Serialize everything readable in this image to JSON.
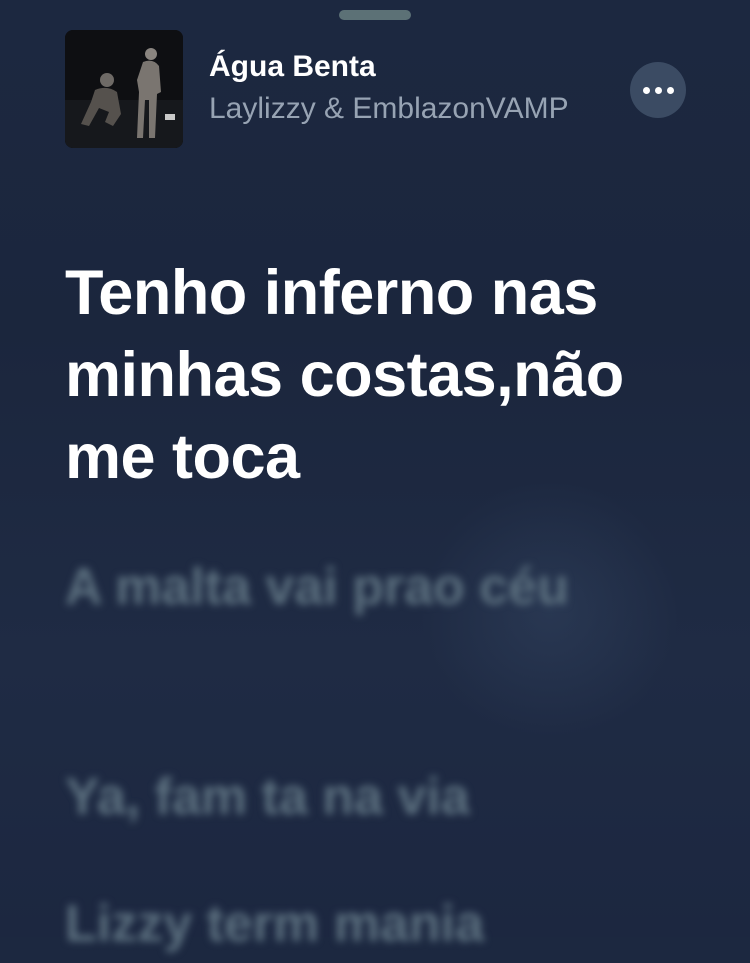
{
  "now_playing": {
    "title": "Água Benta",
    "artist": "Laylizzy & EmblazonVAMP"
  },
  "lyrics": {
    "previous_faded": "",
    "current": "Tenho inferno nas minhas costas,não me toca",
    "upcoming": [
      "A malta vai prao céu",
      "Ya, fam ta na via",
      "Lizzy term mania"
    ]
  },
  "controls": {
    "more_icon": "ellipsis-icon"
  },
  "colors": {
    "background": "#1c2840",
    "current_lyric": "#ffffff",
    "upcoming_lyric": "#5d7180",
    "artist_text": "#97a3b3",
    "more_button_bg": "#3b4b63"
  }
}
